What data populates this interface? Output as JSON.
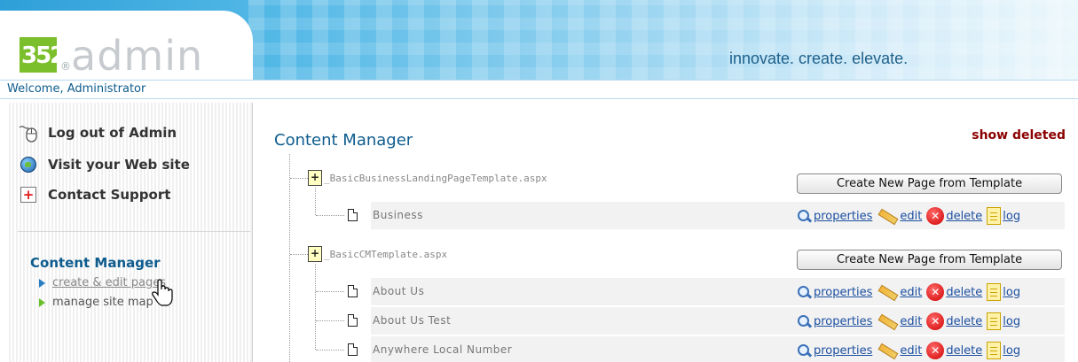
{
  "header": {
    "logo_number": "352",
    "logo_registered": "®",
    "logo_text": "admin",
    "tagline": "innovate. create. elevate."
  },
  "welcome": {
    "text": "Welcome, Administrator"
  },
  "sidebar": {
    "links": [
      {
        "label": "Log out of Admin",
        "icon": "mouse-icon"
      },
      {
        "label": "Visit your Web site",
        "icon": "globe-icon"
      },
      {
        "label": "Contact Support",
        "icon": "first-aid-icon"
      }
    ],
    "section_heading": "Content Manager",
    "sub_items": [
      {
        "label": "create & edit pages",
        "color": "#2a7fc2",
        "active": true
      },
      {
        "label": "manage site map",
        "color": "#6cbf2c",
        "active": false
      }
    ]
  },
  "main": {
    "title": "Content Manager",
    "show_deleted_label": "show deleted",
    "create_button_label": "Create New Page from Template",
    "actions": {
      "properties": "properties",
      "edit": "edit",
      "delete": "delete",
      "log": "log"
    },
    "templates": [
      {
        "name": "_BasicBusinessLandingPageTemplate.aspx",
        "pages": [
          "Business"
        ]
      },
      {
        "name": "_BasicCMTemplate.aspx",
        "pages": [
          "About Us",
          "About Us Test",
          "Anywhere Local Number"
        ]
      }
    ]
  },
  "colors": {
    "accent_blue": "#0e5c8e",
    "show_deleted": "#8b0000",
    "logo_green": "#7cbf2c"
  }
}
